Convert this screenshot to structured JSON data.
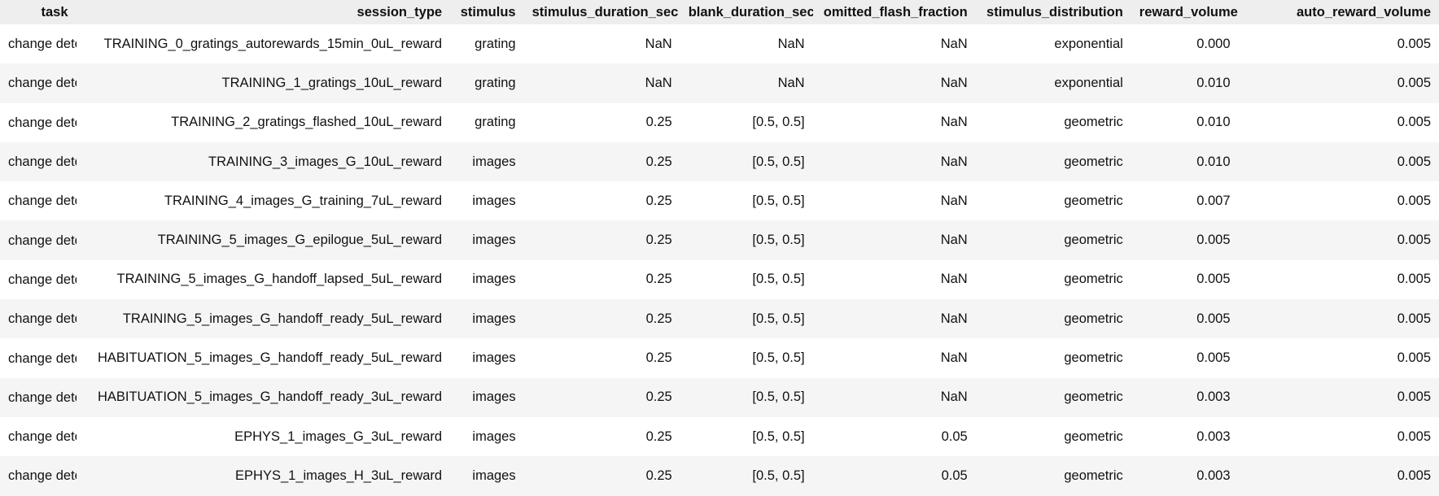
{
  "table": {
    "columns": [
      "task",
      "session_type",
      "stimulus",
      "stimulus_duration_sec",
      "blank_duration_sec",
      "omitted_flash_fraction",
      "stimulus_distribution",
      "reward_volume",
      "auto_reward_volume"
    ],
    "rows": [
      [
        "change detection",
        "TRAINING_0_gratings_autorewards_15min_0uL_reward",
        "grating",
        "NaN",
        "NaN",
        "NaN",
        "exponential",
        "0.000",
        "0.005"
      ],
      [
        "change detection",
        "TRAINING_1_gratings_10uL_reward",
        "grating",
        "NaN",
        "NaN",
        "NaN",
        "exponential",
        "0.010",
        "0.005"
      ],
      [
        "change detection",
        "TRAINING_2_gratings_flashed_10uL_reward",
        "grating",
        "0.25",
        "[0.5, 0.5]",
        "NaN",
        "geometric",
        "0.010",
        "0.005"
      ],
      [
        "change detection",
        "TRAINING_3_images_G_10uL_reward",
        "images",
        "0.25",
        "[0.5, 0.5]",
        "NaN",
        "geometric",
        "0.010",
        "0.005"
      ],
      [
        "change detection",
        "TRAINING_4_images_G_training_7uL_reward",
        "images",
        "0.25",
        "[0.5, 0.5]",
        "NaN",
        "geometric",
        "0.007",
        "0.005"
      ],
      [
        "change detection",
        "TRAINING_5_images_G_epilogue_5uL_reward",
        "images",
        "0.25",
        "[0.5, 0.5]",
        "NaN",
        "geometric",
        "0.005",
        "0.005"
      ],
      [
        "change detection",
        "TRAINING_5_images_G_handoff_lapsed_5uL_reward",
        "images",
        "0.25",
        "[0.5, 0.5]",
        "NaN",
        "geometric",
        "0.005",
        "0.005"
      ],
      [
        "change detection",
        "TRAINING_5_images_G_handoff_ready_5uL_reward",
        "images",
        "0.25",
        "[0.5, 0.5]",
        "NaN",
        "geometric",
        "0.005",
        "0.005"
      ],
      [
        "change detection",
        "HABITUATION_5_images_G_handoff_ready_5uL_reward",
        "images",
        "0.25",
        "[0.5, 0.5]",
        "NaN",
        "geometric",
        "0.005",
        "0.005"
      ],
      [
        "change detection",
        "HABITUATION_5_images_G_handoff_ready_3uL_reward",
        "images",
        "0.25",
        "[0.5, 0.5]",
        "NaN",
        "geometric",
        "0.003",
        "0.005"
      ],
      [
        "change detection",
        "EPHYS_1_images_G_3uL_reward",
        "images",
        "0.25",
        "[0.5, 0.5]",
        "0.05",
        "geometric",
        "0.003",
        "0.005"
      ],
      [
        "change detection",
        "EPHYS_1_images_H_3uL_reward",
        "images",
        "0.25",
        "[0.5, 0.5]",
        "0.05",
        "geometric",
        "0.003",
        "0.005"
      ]
    ]
  }
}
